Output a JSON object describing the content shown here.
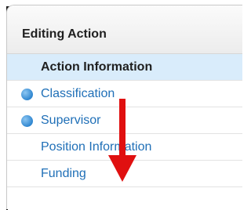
{
  "header": {
    "title": "Editing Action"
  },
  "nav": {
    "items": [
      {
        "label": "Action Information",
        "state": "active",
        "checked": false
      },
      {
        "label": "Classification",
        "state": "link",
        "checked": true
      },
      {
        "label": "Supervisor",
        "state": "link",
        "checked": true
      },
      {
        "label": "Position Information",
        "state": "link",
        "checked": false
      },
      {
        "label": "Funding",
        "state": "link",
        "checked": false
      }
    ]
  },
  "annotation": {
    "arrow_color": "#e01010",
    "direction": "down"
  },
  "colors": {
    "link": "#1f6fb7",
    "active_bg": "#d9ecfb",
    "check": "#2f86d0"
  }
}
